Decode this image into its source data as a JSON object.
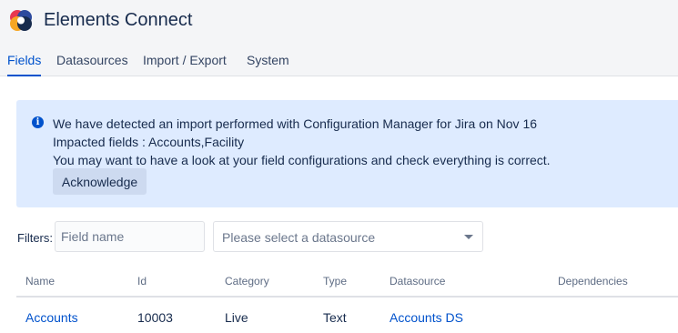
{
  "app": {
    "title": "Elements Connect",
    "logo_icon": "elements-connect-logo"
  },
  "tabs": [
    {
      "label": "Fields",
      "active": true
    },
    {
      "label": "Datasources",
      "active": false
    },
    {
      "label": "Import / Export",
      "active": false
    },
    {
      "label": "System",
      "active": false
    }
  ],
  "banner": {
    "icon": "info-icon",
    "line1": "We have detected an import performed with Configuration Manager for Jira on Nov 16",
    "line2": "Impacted fields : Accounts,Facility",
    "line3": "You may want to have a look at your field configurations and check everything is correct.",
    "button_label": "Acknowledge"
  },
  "filters": {
    "label": "Filters:",
    "field_name_placeholder": "Field name",
    "field_name_value": "",
    "datasource_placeholder": "Please select a datasource"
  },
  "table": {
    "columns": [
      "Name",
      "Id",
      "Category",
      "Type",
      "Datasource",
      "Dependencies"
    ],
    "rows": [
      {
        "name": "Accounts",
        "id": "10003",
        "category": "Live",
        "type": "Text",
        "datasource": "Accounts DS",
        "dependencies": ""
      }
    ]
  },
  "colors": {
    "accent": "#0052cc",
    "banner_bg": "#deebff",
    "header_bg": "#f4f5f7"
  }
}
